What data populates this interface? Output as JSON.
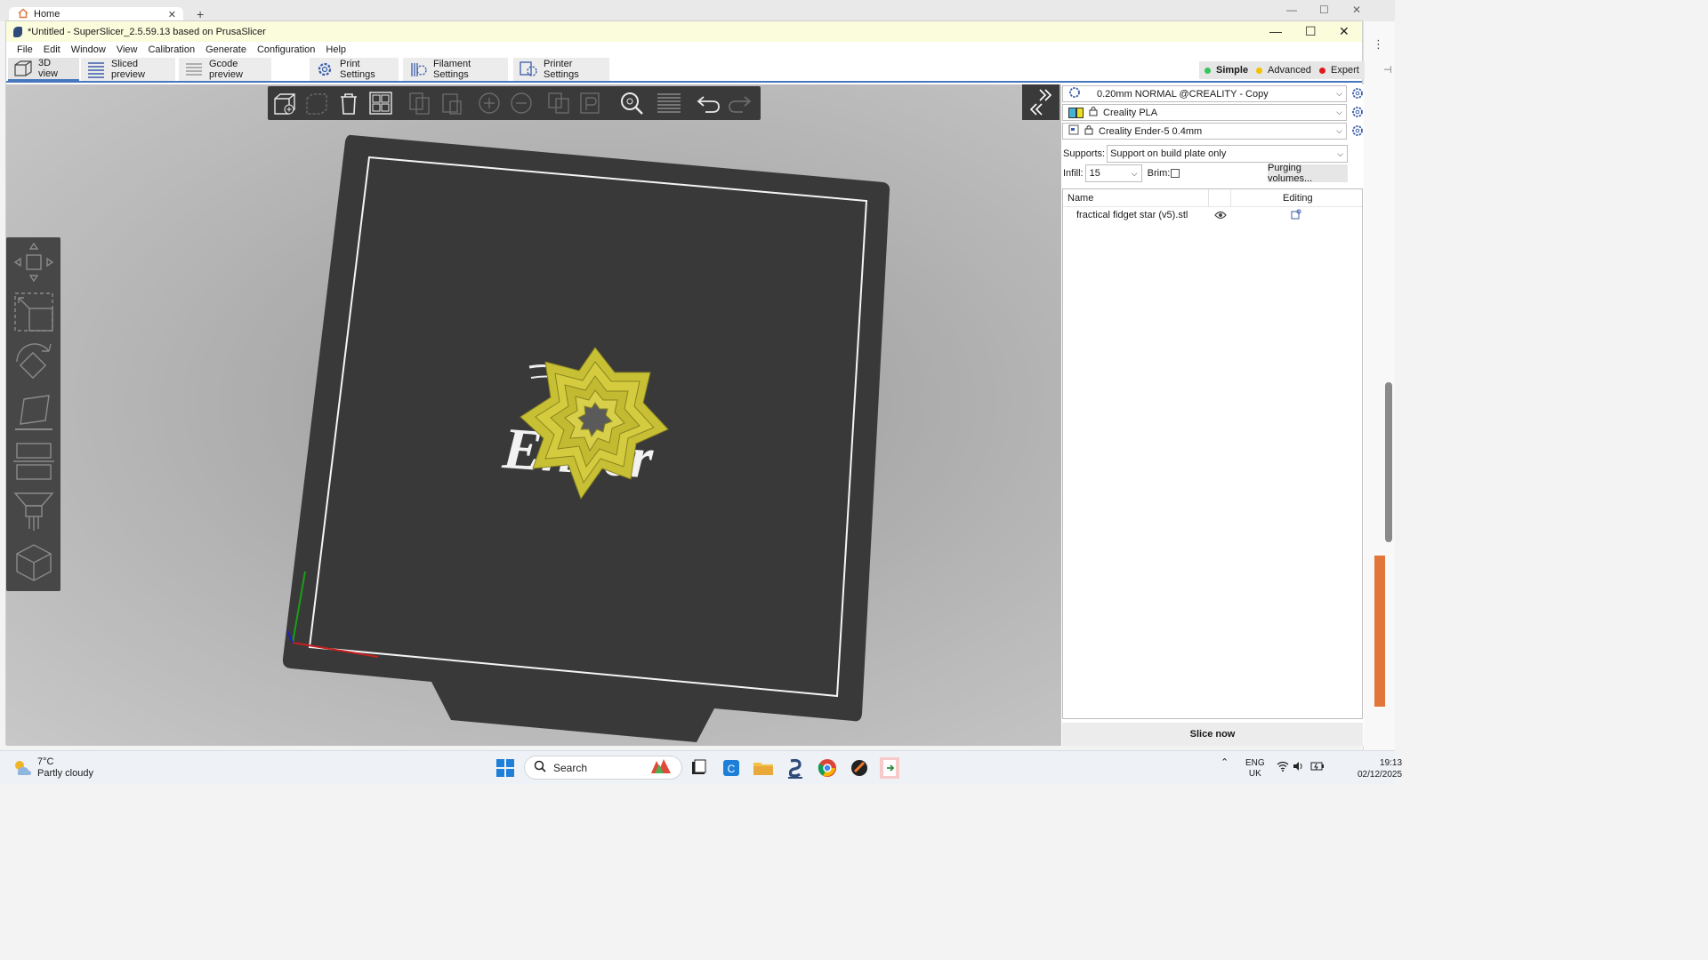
{
  "browser": {
    "tab_title": "Home",
    "tab_close": "✕",
    "new_tab": "+"
  },
  "window": {
    "title": "*Untitled - SuperSlicer_2.5.59.13  based on PrusaSlicer",
    "minimize": "—",
    "maximize": "☐",
    "close": "✕"
  },
  "menu": [
    "File",
    "Edit",
    "Window",
    "View",
    "Calibration",
    "Generate",
    "Configuration",
    "Help"
  ],
  "tabs": {
    "view3d": "3D view",
    "sliced_preview": "Sliced preview",
    "gcode_preview": "Gcode preview",
    "print_settings": "Print Settings",
    "filament_settings": "Filament Settings",
    "printer_settings": "Printer Settings"
  },
  "modes": {
    "simple": {
      "label": "Simple",
      "color": "#34c759"
    },
    "advanced": {
      "label": "Advanced",
      "color": "#f2c200"
    },
    "expert": {
      "label": "Expert",
      "color": "#e0191b"
    }
  },
  "toolbar3d_icons": [
    "add-icon",
    "delete-icon",
    "delete-all-icon",
    "arrange-icon",
    "copy-icon",
    "paste-icon",
    "add-instance-icon",
    "remove-instance-icon",
    "split-objects-icon",
    "split-parts-icon",
    "search-icon",
    "layers-icon",
    "undo-icon",
    "redo-icon"
  ],
  "gizmo_icons": [
    "move-icon",
    "scale-icon",
    "rotate-icon",
    "place-on-face-icon",
    "cut-icon",
    "paint-supports-icon",
    "sla-hollow-icon"
  ],
  "presets": {
    "print": "0.20mm NORMAL @CREALITY - Copy",
    "filament": "Creality PLA",
    "printer": "Creality Ender-5 0.4mm"
  },
  "supports": {
    "label": "Supports:",
    "value": "Support on build plate only"
  },
  "infill": {
    "label": "Infill:",
    "value": "15"
  },
  "brim": {
    "label": "Brim:"
  },
  "purging_button": "Purging volumes...",
  "object_list": {
    "col_name": "Name",
    "col_editing": "Editing",
    "rows": [
      {
        "name": "fractical fidget star (v5).stl"
      }
    ]
  },
  "slice_button": "Slice now",
  "bed_logo": "Ender",
  "taskbar": {
    "weather_temp": "7°C",
    "weather_desc": "Partly cloudy",
    "search_placeholder": "Search",
    "lang_top": "ENG",
    "lang_bottom": "UK",
    "time": "19:13",
    "date": "02/12/2025"
  }
}
